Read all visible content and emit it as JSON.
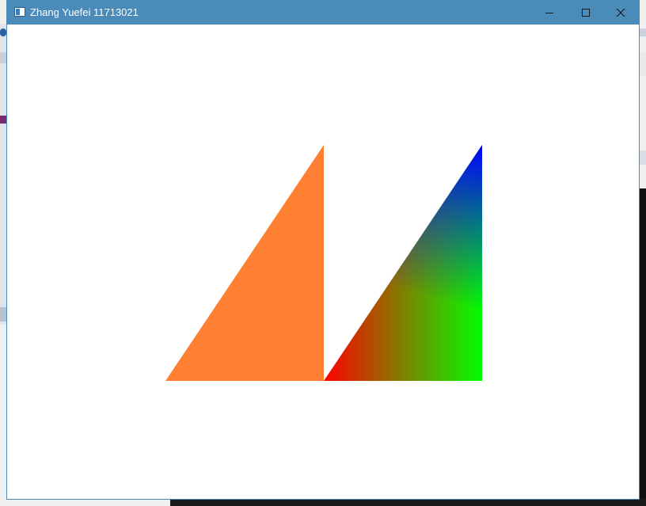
{
  "window": {
    "title": "Zhang Yuefei 11713021",
    "titlebar_color": "#4b8bb9",
    "controls": {
      "minimize": "minimize-icon",
      "maximize": "maximize-icon",
      "close": "close-icon"
    }
  },
  "canvas": {
    "background_color": "#ffffff",
    "left_triangle": {
      "fill_color": "#ff8033"
    },
    "right_triangle": {
      "vertex_colors": {
        "bottom_left": "#ff0000",
        "bottom_right": "#00ff00",
        "top": "#0000ff"
      }
    }
  }
}
